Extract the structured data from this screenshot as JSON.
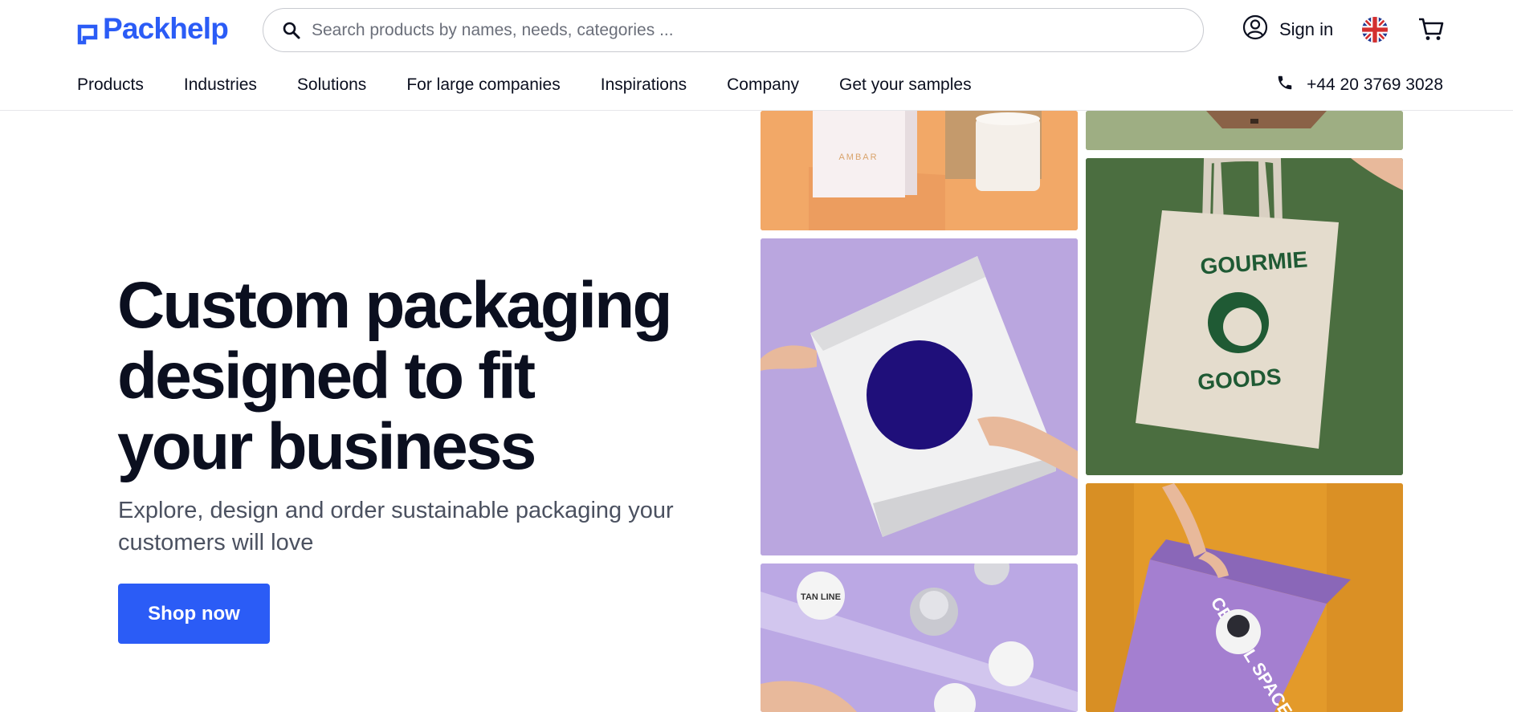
{
  "brand": {
    "name": "Packhelp",
    "color": "#2b5cf6"
  },
  "search": {
    "placeholder": "Search products by names, needs, categories ..."
  },
  "header": {
    "signin_label": "Sign in",
    "phone": "+44 20 3769 3028"
  },
  "nav": {
    "items": [
      "Products",
      "Industries",
      "Solutions",
      "For large companies",
      "Inspirations",
      "Company",
      "Get your samples"
    ]
  },
  "hero": {
    "title": "Custom packaging designed to fit your business",
    "subtitle": "Explore, design and order sustainable packaging your customers will love",
    "cta_label": "Shop now"
  },
  "gallery": {
    "box_label": "AMBAR",
    "tote_text_top": "GOURMIE",
    "tote_text_bottom": "GOODS",
    "sticker_text": "TAN LINE",
    "cereal_text": "CEREAL SPACE"
  },
  "colors": {
    "accent": "#2b5cf6",
    "text": "#0b0f1f",
    "muted": "#4b5160"
  }
}
